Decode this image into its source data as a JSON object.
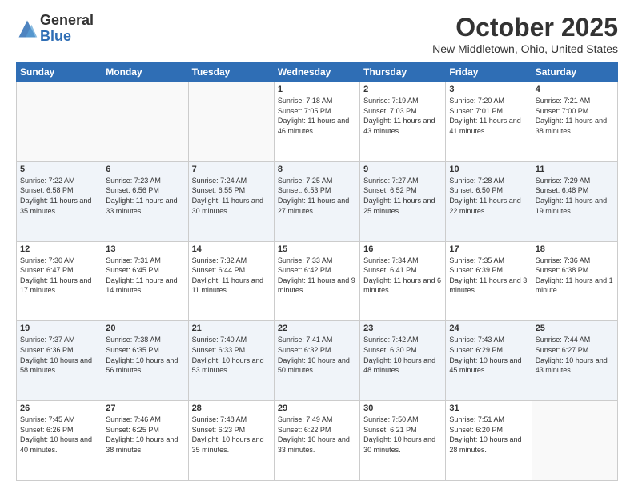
{
  "logo": {
    "general": "General",
    "blue": "Blue"
  },
  "title": "October 2025",
  "location": "New Middletown, Ohio, United States",
  "days_of_week": [
    "Sunday",
    "Monday",
    "Tuesday",
    "Wednesday",
    "Thursday",
    "Friday",
    "Saturday"
  ],
  "weeks": [
    [
      {
        "day": "",
        "info": ""
      },
      {
        "day": "",
        "info": ""
      },
      {
        "day": "",
        "info": ""
      },
      {
        "day": "1",
        "info": "Sunrise: 7:18 AM\nSunset: 7:05 PM\nDaylight: 11 hours and 46 minutes."
      },
      {
        "day": "2",
        "info": "Sunrise: 7:19 AM\nSunset: 7:03 PM\nDaylight: 11 hours and 43 minutes."
      },
      {
        "day": "3",
        "info": "Sunrise: 7:20 AM\nSunset: 7:01 PM\nDaylight: 11 hours and 41 minutes."
      },
      {
        "day": "4",
        "info": "Sunrise: 7:21 AM\nSunset: 7:00 PM\nDaylight: 11 hours and 38 minutes."
      }
    ],
    [
      {
        "day": "5",
        "info": "Sunrise: 7:22 AM\nSunset: 6:58 PM\nDaylight: 11 hours and 35 minutes."
      },
      {
        "day": "6",
        "info": "Sunrise: 7:23 AM\nSunset: 6:56 PM\nDaylight: 11 hours and 33 minutes."
      },
      {
        "day": "7",
        "info": "Sunrise: 7:24 AM\nSunset: 6:55 PM\nDaylight: 11 hours and 30 minutes."
      },
      {
        "day": "8",
        "info": "Sunrise: 7:25 AM\nSunset: 6:53 PM\nDaylight: 11 hours and 27 minutes."
      },
      {
        "day": "9",
        "info": "Sunrise: 7:27 AM\nSunset: 6:52 PM\nDaylight: 11 hours and 25 minutes."
      },
      {
        "day": "10",
        "info": "Sunrise: 7:28 AM\nSunset: 6:50 PM\nDaylight: 11 hours and 22 minutes."
      },
      {
        "day": "11",
        "info": "Sunrise: 7:29 AM\nSunset: 6:48 PM\nDaylight: 11 hours and 19 minutes."
      }
    ],
    [
      {
        "day": "12",
        "info": "Sunrise: 7:30 AM\nSunset: 6:47 PM\nDaylight: 11 hours and 17 minutes."
      },
      {
        "day": "13",
        "info": "Sunrise: 7:31 AM\nSunset: 6:45 PM\nDaylight: 11 hours and 14 minutes."
      },
      {
        "day": "14",
        "info": "Sunrise: 7:32 AM\nSunset: 6:44 PM\nDaylight: 11 hours and 11 minutes."
      },
      {
        "day": "15",
        "info": "Sunrise: 7:33 AM\nSunset: 6:42 PM\nDaylight: 11 hours and 9 minutes."
      },
      {
        "day": "16",
        "info": "Sunrise: 7:34 AM\nSunset: 6:41 PM\nDaylight: 11 hours and 6 minutes."
      },
      {
        "day": "17",
        "info": "Sunrise: 7:35 AM\nSunset: 6:39 PM\nDaylight: 11 hours and 3 minutes."
      },
      {
        "day": "18",
        "info": "Sunrise: 7:36 AM\nSunset: 6:38 PM\nDaylight: 11 hours and 1 minute."
      }
    ],
    [
      {
        "day": "19",
        "info": "Sunrise: 7:37 AM\nSunset: 6:36 PM\nDaylight: 10 hours and 58 minutes."
      },
      {
        "day": "20",
        "info": "Sunrise: 7:38 AM\nSunset: 6:35 PM\nDaylight: 10 hours and 56 minutes."
      },
      {
        "day": "21",
        "info": "Sunrise: 7:40 AM\nSunset: 6:33 PM\nDaylight: 10 hours and 53 minutes."
      },
      {
        "day": "22",
        "info": "Sunrise: 7:41 AM\nSunset: 6:32 PM\nDaylight: 10 hours and 50 minutes."
      },
      {
        "day": "23",
        "info": "Sunrise: 7:42 AM\nSunset: 6:30 PM\nDaylight: 10 hours and 48 minutes."
      },
      {
        "day": "24",
        "info": "Sunrise: 7:43 AM\nSunset: 6:29 PM\nDaylight: 10 hours and 45 minutes."
      },
      {
        "day": "25",
        "info": "Sunrise: 7:44 AM\nSunset: 6:27 PM\nDaylight: 10 hours and 43 minutes."
      }
    ],
    [
      {
        "day": "26",
        "info": "Sunrise: 7:45 AM\nSunset: 6:26 PM\nDaylight: 10 hours and 40 minutes."
      },
      {
        "day": "27",
        "info": "Sunrise: 7:46 AM\nSunset: 6:25 PM\nDaylight: 10 hours and 38 minutes."
      },
      {
        "day": "28",
        "info": "Sunrise: 7:48 AM\nSunset: 6:23 PM\nDaylight: 10 hours and 35 minutes."
      },
      {
        "day": "29",
        "info": "Sunrise: 7:49 AM\nSunset: 6:22 PM\nDaylight: 10 hours and 33 minutes."
      },
      {
        "day": "30",
        "info": "Sunrise: 7:50 AM\nSunset: 6:21 PM\nDaylight: 10 hours and 30 minutes."
      },
      {
        "day": "31",
        "info": "Sunrise: 7:51 AM\nSunset: 6:20 PM\nDaylight: 10 hours and 28 minutes."
      },
      {
        "day": "",
        "info": ""
      }
    ]
  ]
}
